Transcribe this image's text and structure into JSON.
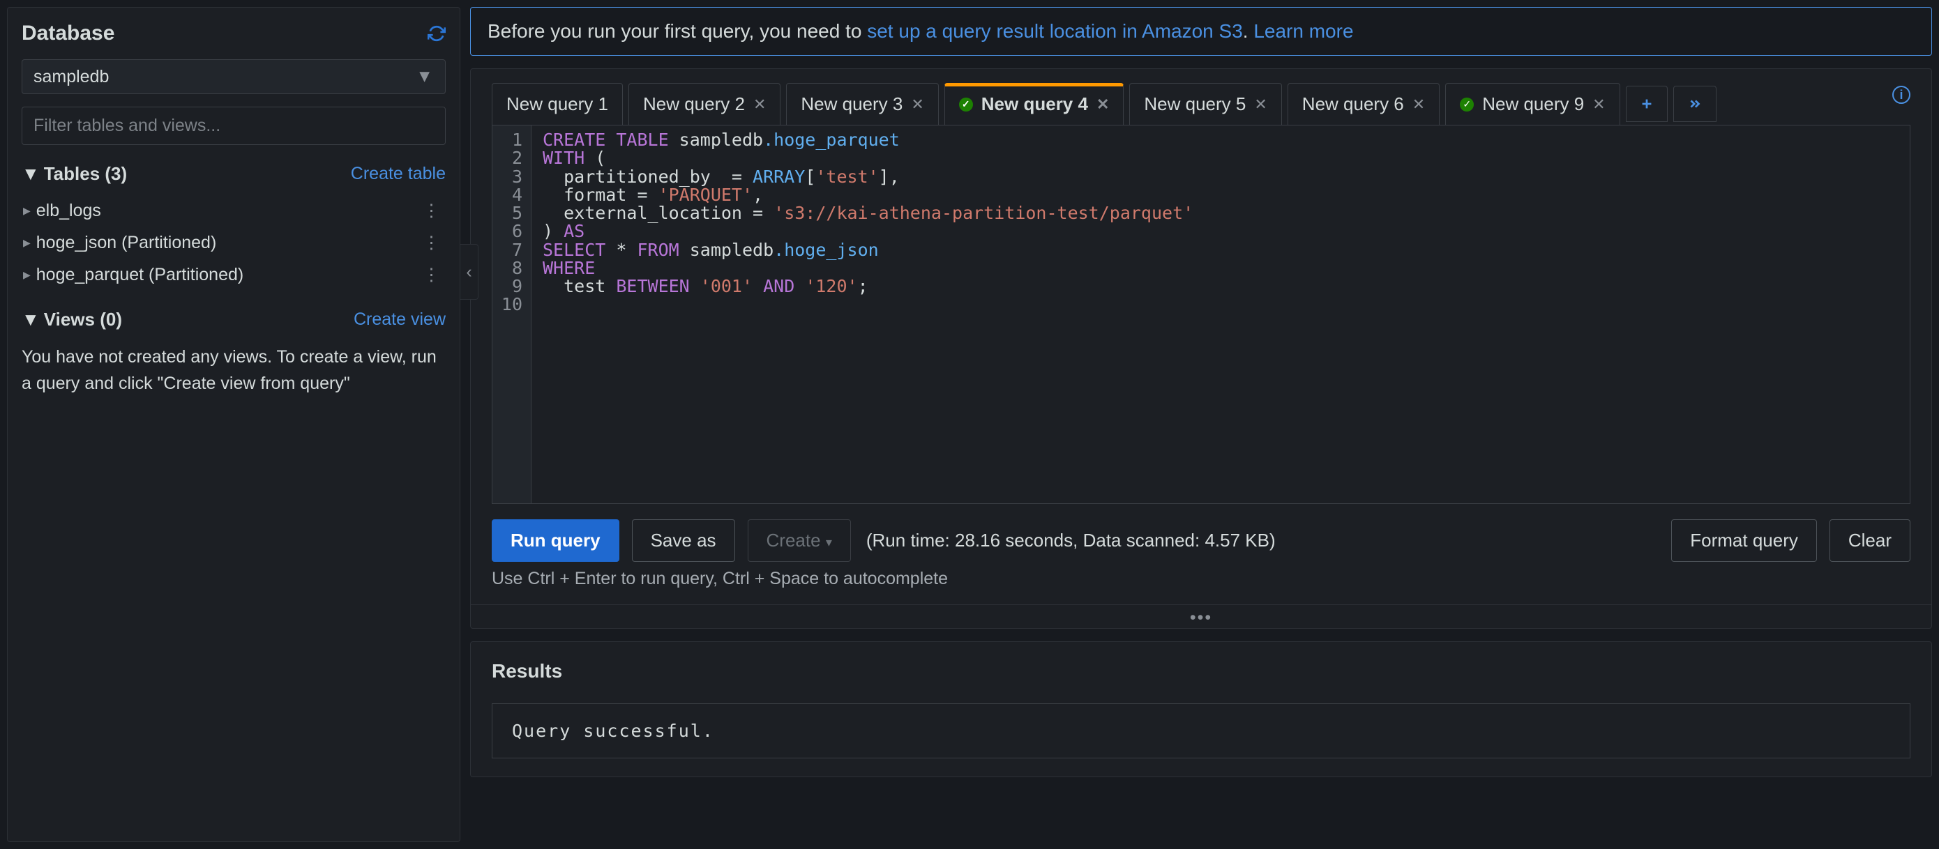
{
  "sidebar": {
    "title": "Database",
    "selected_db": "sampledb",
    "filter_placeholder": "Filter tables and views...",
    "tables_label": "Tables (3)",
    "create_table": "Create table",
    "tables": [
      {
        "name": "elb_logs"
      },
      {
        "name": "hoge_json (Partitioned)"
      },
      {
        "name": "hoge_parquet (Partitioned)"
      }
    ],
    "views_label": "Views (0)",
    "create_view": "Create view",
    "views_hint": "You have not created any views. To create a view, run a query and click \"Create view from query\""
  },
  "alert": {
    "prefix": "Before you run your first query, you need to ",
    "link1": "set up a query result location in Amazon S3",
    "sep": ". ",
    "link2": "Learn more"
  },
  "tabs": [
    {
      "label": "New query 1",
      "closable": false,
      "status": null,
      "active": false
    },
    {
      "label": "New query 2",
      "closable": true,
      "status": null,
      "active": false
    },
    {
      "label": "New query 3",
      "closable": true,
      "status": null,
      "active": false
    },
    {
      "label": "New query 4",
      "closable": true,
      "status": "ok",
      "active": true
    },
    {
      "label": "New query 5",
      "closable": true,
      "status": null,
      "active": false
    },
    {
      "label": "New query 6",
      "closable": true,
      "status": null,
      "active": false
    },
    {
      "label": "New query 9",
      "closable": true,
      "status": "ok",
      "active": false
    }
  ],
  "editor": {
    "line_numbers": [
      "1",
      "2",
      "3",
      "4",
      "5",
      "6",
      "7",
      "8",
      "9",
      "10"
    ],
    "tokens": [
      [
        {
          "t": "CREATE TABLE",
          "c": "kw"
        },
        {
          "t": " sampledb",
          "c": "pl"
        },
        {
          "t": ".hoge_parquet",
          "c": "fn"
        }
      ],
      [
        {
          "t": "WITH",
          "c": "kw"
        },
        {
          "t": " (",
          "c": "pl"
        }
      ],
      [
        {
          "t": "  partitioned_by  = ",
          "c": "pl"
        },
        {
          "t": "ARRAY",
          "c": "fn"
        },
        {
          "t": "[",
          "c": "pl"
        },
        {
          "t": "'test'",
          "c": "str"
        },
        {
          "t": "],",
          "c": "pl"
        }
      ],
      [
        {
          "t": "  format = ",
          "c": "pl"
        },
        {
          "t": "'PARQUET'",
          "c": "str"
        },
        {
          "t": ",",
          "c": "pl"
        }
      ],
      [
        {
          "t": "  external_location = ",
          "c": "pl"
        },
        {
          "t": "'s3://kai-athena-partition-test/parquet'",
          "c": "str"
        }
      ],
      [
        {
          "t": ") ",
          "c": "pl"
        },
        {
          "t": "AS",
          "c": "kw"
        }
      ],
      [
        {
          "t": "SELECT",
          "c": "kw"
        },
        {
          "t": " * ",
          "c": "pl"
        },
        {
          "t": "FROM",
          "c": "kw"
        },
        {
          "t": " sampledb",
          "c": "pl"
        },
        {
          "t": ".hoge_json",
          "c": "fn"
        }
      ],
      [
        {
          "t": "WHERE",
          "c": "kw"
        }
      ],
      [
        {
          "t": "  test ",
          "c": "pl"
        },
        {
          "t": "BETWEEN",
          "c": "kw"
        },
        {
          "t": " ",
          "c": "pl"
        },
        {
          "t": "'001'",
          "c": "str"
        },
        {
          "t": " ",
          "c": "pl"
        },
        {
          "t": "AND",
          "c": "kw"
        },
        {
          "t": " ",
          "c": "pl"
        },
        {
          "t": "'120'",
          "c": "str"
        },
        {
          "t": ";",
          "c": "pl"
        }
      ],
      []
    ]
  },
  "actions": {
    "run": "Run query",
    "save": "Save as",
    "create": "Create",
    "info": "(Run time: 28.16 seconds, Data scanned: 4.57 KB)",
    "format": "Format query",
    "clear": "Clear",
    "hint": "Use Ctrl + Enter to run query, Ctrl + Space to autocomplete"
  },
  "results": {
    "title": "Results",
    "message": "Query successful."
  }
}
